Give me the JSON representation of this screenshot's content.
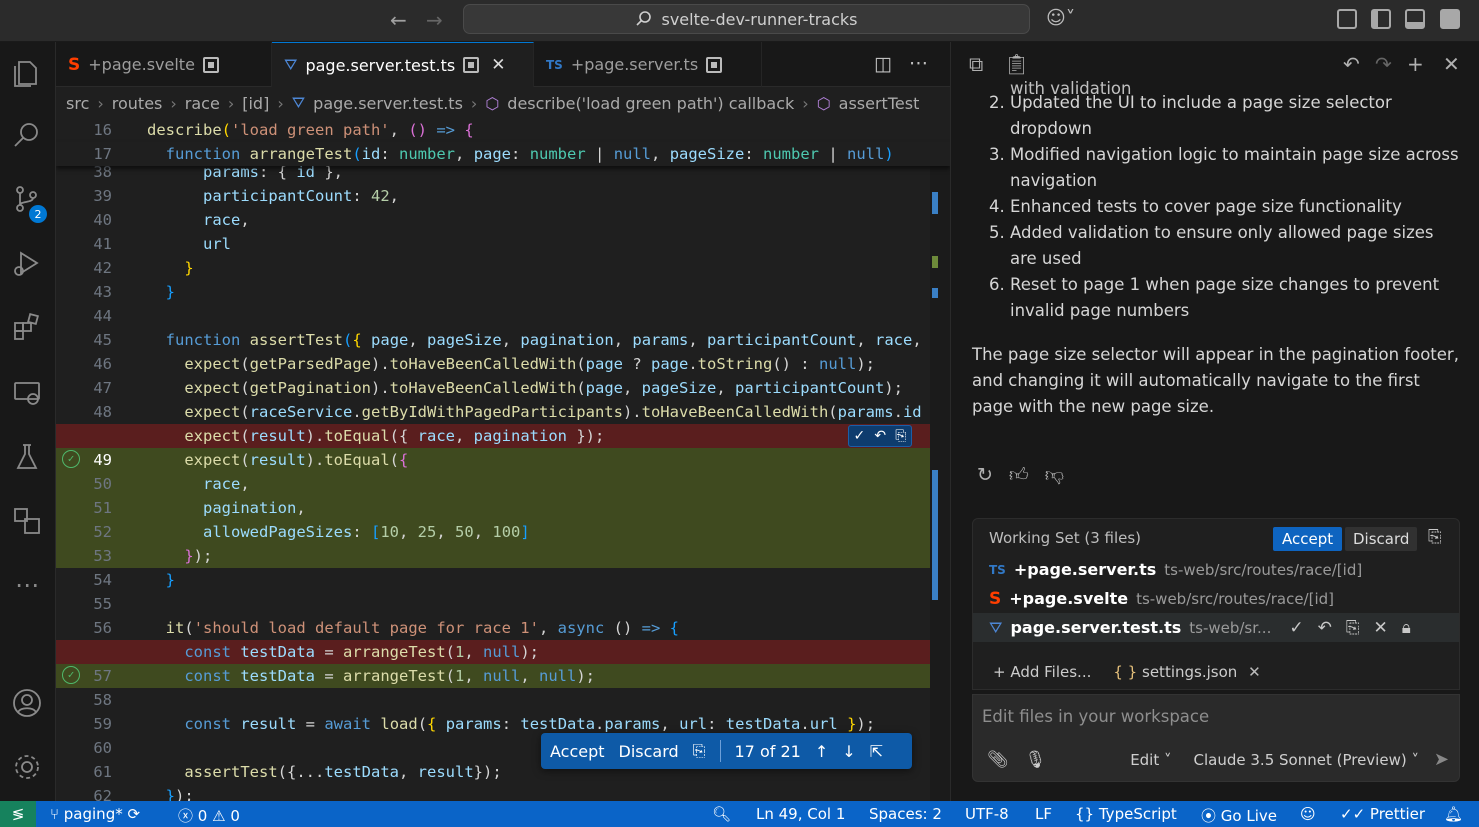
{
  "titlebar": {
    "search": "svelte-dev-runner-tracks"
  },
  "activity": {
    "scm_badge": "2"
  },
  "tabs": [
    {
      "label": "+page.svelte",
      "icon": "svelte-icon",
      "dirty": true
    },
    {
      "label": "page.server.test.ts",
      "icon": "test-icon",
      "dirty": true,
      "active": true
    },
    {
      "label": "+page.server.ts",
      "icon": "ts-icon",
      "dirty": true
    }
  ],
  "breadcrumb": [
    "src",
    "routes",
    "race",
    "[id]",
    "page.server.test.ts",
    "describe('load green path') callback",
    "assertTest"
  ],
  "editor": {
    "sticky": [
      {
        "num": "16",
        "html": "<span class='fn'>describe</span><span class='br'>(</span><span class='str'>'load green path'</span>, <span class='br2'>()</span> <span class='kw'>=&gt;</span> <span class='br2'>{</span>"
      },
      {
        "num": "17",
        "html": "  <span class='kw'>function</span> <span class='fn'>arrangeTest</span><span class='br3'>(</span><span class='var'>id</span>: <span class='ty'>number</span>, <span class='var'>page</span>: <span class='ty'>number</span> | <span class='kw'>null</span>, <span class='var'>pageSize</span>: <span class='ty'>number</span> | <span class='kw'>null</span><span class='br3'>)</span>"
      }
    ],
    "lines": [
      {
        "num": "38",
        "html": "      <span class='var'>params</span>: { <span class='var'>id</span> },",
        "partial": true
      },
      {
        "num": "39",
        "html": "      <span class='var'>participantCount</span>: <span class='num'>42</span>,"
      },
      {
        "num": "40",
        "html": "      <span class='var'>race</span>,"
      },
      {
        "num": "41",
        "html": "      <span class='var'>url</span>"
      },
      {
        "num": "42",
        "html": "    <span class='br'>}</span>"
      },
      {
        "num": "43",
        "html": "  <span class='br3'>}</span>"
      },
      {
        "num": "44",
        "html": ""
      },
      {
        "num": "45",
        "html": "  <span class='kw'>function</span> <span class='fn'>assertTest</span><span class='br3'>(</span><span class='br'>{</span> <span class='var'>page</span>, <span class='var'>pageSize</span>, <span class='var'>pagination</span>, <span class='var'>params</span>, <span class='var'>participantCount</span>, <span class='var'>race</span>,"
      },
      {
        "num": "46",
        "html": "    <span class='fn'>expect</span>(<span class='fn'>getParsedPage</span>).<span class='fn'>toHaveBeenCalledWith</span>(<span class='var'>page</span> ? <span class='var'>page</span>.<span class='fn'>toString</span>() : <span class='kw'>null</span>);"
      },
      {
        "num": "47",
        "html": "    <span class='fn'>expect</span>(<span class='fn'>getPagination</span>).<span class='fn'>toHaveBeenCalledWith</span>(<span class='var'>page</span>, <span class='var'>pageSize</span>, <span class='var'>participantCount</span>);"
      },
      {
        "num": "48",
        "html": "    <span class='fn'>expect</span>(<span class='var'>raceService</span>.<span class='fn'>getByIdWithPagedParticipants</span>).<span class='fn'>toHaveBeenCalledWith</span>(<span class='var'>params</span>.<span class='var'>id</span>"
      },
      {
        "num": "",
        "html": "    <span class='fn'>expect</span>(<span class='var'>result</span>).<span class='fn'>toEqual</span>({ <span class='var'>race</span>, <span class='var'>pagination</span> });",
        "type": "del"
      },
      {
        "num": "49",
        "html": "    <span class='fn'>expect</span>(<span class='var'>result</span>).<span class='fn'>toEqual</span>(<span class='br2'>{</span>",
        "type": "add",
        "cur": true,
        "ok": true
      },
      {
        "num": "50",
        "html": "      <span class='var'>race</span>,",
        "type": "add"
      },
      {
        "num": "51",
        "html": "      <span class='var'>pagination</span>,",
        "type": "add"
      },
      {
        "num": "52",
        "html": "      <span class='var'>allowedPageSizes</span>: <span class='br3'>[</span><span class='num'>10</span>, <span class='num'>25</span>, <span class='num'>50</span>, <span class='num'>100</span><span class='br3'>]</span>",
        "type": "add"
      },
      {
        "num": "53",
        "html": "    <span class='br2'>}</span>);",
        "type": "add"
      },
      {
        "num": "54",
        "html": "  <span class='br3'>}</span>"
      },
      {
        "num": "55",
        "html": ""
      },
      {
        "num": "56",
        "html": "  <span class='fn'>it</span>(<span class='str'>'should load default page for race 1'</span>, <span class='kw'>async</span> () <span class='kw'>=&gt;</span> <span class='br3'>{</span>"
      },
      {
        "num": "",
        "html": "    <span class='kw'>const</span> <span class='var'>testData</span> = <span class='fn'>arrangeTest</span>(<span class='num'>1</span>, <span class='kw'>null</span>);",
        "type": "del"
      },
      {
        "num": "57",
        "html": "    <span class='kw'>const</span> <span class='var'>testData</span> = <span class='fn'>arrangeTest</span>(<span class='num'>1</span>, <span class='kw'>null</span>, <span class='kw'>null</span>);",
        "type": "add",
        "ok": true
      },
      {
        "num": "58",
        "html": ""
      },
      {
        "num": "59",
        "html": "    <span class='kw'>const</span> <span class='var'>result</span> = <span class='kw'>await</span> <span class='fn'>load</span>(<span class='br'>{</span> <span class='var'>params</span>: <span class='var'>testData</span>.<span class='var'>params</span>, <span class='var'>url</span>: <span class='var'>testData</span>.<span class='var'>url</span> <span class='br'>}</span>);"
      },
      {
        "num": "60",
        "html": ""
      },
      {
        "num": "61",
        "html": "    <span class='fn'>assertTest</span>({...<span class='var'>testData</span>, <span class='var'>result</span>});"
      },
      {
        "num": "62",
        "html": "  <span class='br3'>}</span>);"
      }
    ]
  },
  "diff_toolbar": {
    "accept": "Accept",
    "discard": "Discard",
    "counter": "17 of 21"
  },
  "chat": {
    "cut_line": "with validation",
    "list": [
      {
        "n": "2.",
        "text": "Updated the UI to include a page size selector dropdown"
      },
      {
        "n": "3.",
        "text": "Modified navigation logic to maintain page size across navigation"
      },
      {
        "n": "4.",
        "text": "Enhanced tests to cover page size functionality"
      },
      {
        "n": "5.",
        "text": "Added validation to ensure only allowed page sizes are used"
      },
      {
        "n": "6.",
        "text": "Reset to page 1 when page size changes to prevent invalid page numbers"
      }
    ],
    "summary": "The page size selector will appear in the pagination footer, and changing it will automatically navigate to the first page with the new page size.",
    "working_set": {
      "title": "Working Set (3 files)",
      "accept": "Accept",
      "discard": "Discard",
      "files": [
        {
          "name": "+page.server.ts",
          "path": "ts-web/src/routes/race/[id]",
          "icon": "ts-icon"
        },
        {
          "name": "+page.svelte",
          "path": "ts-web/src/routes/race/[id]",
          "icon": "svelte-icon"
        },
        {
          "name": "page.server.test.ts",
          "path": "ts-web/sr...",
          "icon": "test-icon",
          "selected": true
        }
      ],
      "add_files": "+ Add Files...",
      "context_file": "settings.json"
    },
    "input": {
      "placeholder": "Edit files in your workspace",
      "mode": "Edit",
      "model": "Claude 3.5 Sonnet (Preview)"
    }
  },
  "statusbar": {
    "branch": "paging*",
    "errors": "0",
    "warnings": "0",
    "position": "Ln 49, Col 1",
    "spaces": "Spaces: 2",
    "encoding": "UTF-8",
    "eol": "LF",
    "language": "TypeScript",
    "golive": "Go Live",
    "prettier": "Prettier"
  }
}
